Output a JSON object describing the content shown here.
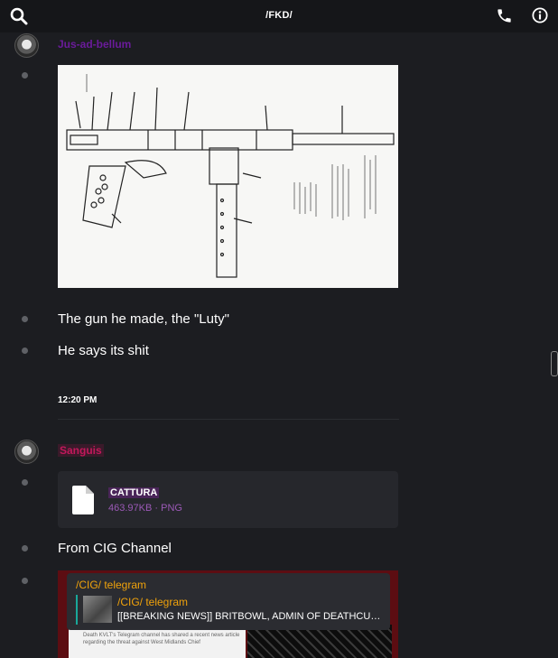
{
  "header": {
    "title": "/FKD/",
    "icons": [
      "search-icon",
      "phone-icon",
      "info-icon"
    ]
  },
  "messages": {
    "group1": {
      "username": "Jus-ad-bellum",
      "username_color": "#6a1b9a",
      "texts": [
        "The gun he made, the \"Luty\"",
        "He says its shit"
      ]
    },
    "timestamp": "12:20 PM",
    "group2": {
      "username": "Sanguis",
      "username_color": "#c2185b",
      "file": {
        "name": "CATTURA",
        "size": "463.97KB",
        "separator": "·",
        "type": "PNG"
      },
      "text": "From CIG Channel",
      "link_preview": {
        "channel": "/CIG/ telegram",
        "quote_name": "/CIG/ telegram",
        "quote_text": "[[BREAKING NEWS]] BRITBOWL, ADMIN OF DEATHCULT P...",
        "article_text": "Death KVLT's Telegram channel has shared a recent news article regarding the threat against West Midlands Chief"
      }
    }
  },
  "colors": {
    "background": "#1c1d21",
    "header": "#151619",
    "quote_title": "#f0a20b",
    "quote_bar": "#19a89a",
    "file_meta": "#9b59b6"
  }
}
